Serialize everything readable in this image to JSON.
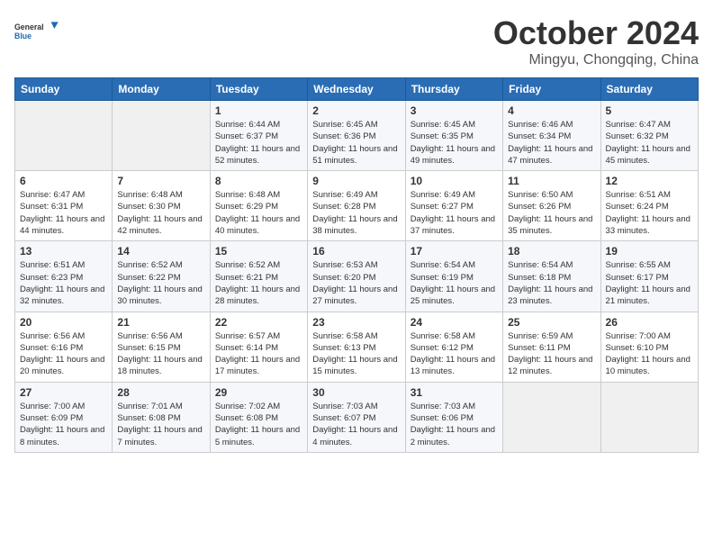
{
  "logo": {
    "general": "General",
    "blue": "Blue"
  },
  "title": "October 2024",
  "subtitle": "Mingyu, Chongqing, China",
  "weekdays": [
    "Sunday",
    "Monday",
    "Tuesday",
    "Wednesday",
    "Thursday",
    "Friday",
    "Saturday"
  ],
  "weeks": [
    [
      {
        "day": "",
        "sunrise": "",
        "sunset": "",
        "daylight": ""
      },
      {
        "day": "",
        "sunrise": "",
        "sunset": "",
        "daylight": ""
      },
      {
        "day": "1",
        "sunrise": "Sunrise: 6:44 AM",
        "sunset": "Sunset: 6:37 PM",
        "daylight": "Daylight: 11 hours and 52 minutes."
      },
      {
        "day": "2",
        "sunrise": "Sunrise: 6:45 AM",
        "sunset": "Sunset: 6:36 PM",
        "daylight": "Daylight: 11 hours and 51 minutes."
      },
      {
        "day": "3",
        "sunrise": "Sunrise: 6:45 AM",
        "sunset": "Sunset: 6:35 PM",
        "daylight": "Daylight: 11 hours and 49 minutes."
      },
      {
        "day": "4",
        "sunrise": "Sunrise: 6:46 AM",
        "sunset": "Sunset: 6:34 PM",
        "daylight": "Daylight: 11 hours and 47 minutes."
      },
      {
        "day": "5",
        "sunrise": "Sunrise: 6:47 AM",
        "sunset": "Sunset: 6:32 PM",
        "daylight": "Daylight: 11 hours and 45 minutes."
      }
    ],
    [
      {
        "day": "6",
        "sunrise": "Sunrise: 6:47 AM",
        "sunset": "Sunset: 6:31 PM",
        "daylight": "Daylight: 11 hours and 44 minutes."
      },
      {
        "day": "7",
        "sunrise": "Sunrise: 6:48 AM",
        "sunset": "Sunset: 6:30 PM",
        "daylight": "Daylight: 11 hours and 42 minutes."
      },
      {
        "day": "8",
        "sunrise": "Sunrise: 6:48 AM",
        "sunset": "Sunset: 6:29 PM",
        "daylight": "Daylight: 11 hours and 40 minutes."
      },
      {
        "day": "9",
        "sunrise": "Sunrise: 6:49 AM",
        "sunset": "Sunset: 6:28 PM",
        "daylight": "Daylight: 11 hours and 38 minutes."
      },
      {
        "day": "10",
        "sunrise": "Sunrise: 6:49 AM",
        "sunset": "Sunset: 6:27 PM",
        "daylight": "Daylight: 11 hours and 37 minutes."
      },
      {
        "day": "11",
        "sunrise": "Sunrise: 6:50 AM",
        "sunset": "Sunset: 6:26 PM",
        "daylight": "Daylight: 11 hours and 35 minutes."
      },
      {
        "day": "12",
        "sunrise": "Sunrise: 6:51 AM",
        "sunset": "Sunset: 6:24 PM",
        "daylight": "Daylight: 11 hours and 33 minutes."
      }
    ],
    [
      {
        "day": "13",
        "sunrise": "Sunrise: 6:51 AM",
        "sunset": "Sunset: 6:23 PM",
        "daylight": "Daylight: 11 hours and 32 minutes."
      },
      {
        "day": "14",
        "sunrise": "Sunrise: 6:52 AM",
        "sunset": "Sunset: 6:22 PM",
        "daylight": "Daylight: 11 hours and 30 minutes."
      },
      {
        "day": "15",
        "sunrise": "Sunrise: 6:52 AM",
        "sunset": "Sunset: 6:21 PM",
        "daylight": "Daylight: 11 hours and 28 minutes."
      },
      {
        "day": "16",
        "sunrise": "Sunrise: 6:53 AM",
        "sunset": "Sunset: 6:20 PM",
        "daylight": "Daylight: 11 hours and 27 minutes."
      },
      {
        "day": "17",
        "sunrise": "Sunrise: 6:54 AM",
        "sunset": "Sunset: 6:19 PM",
        "daylight": "Daylight: 11 hours and 25 minutes."
      },
      {
        "day": "18",
        "sunrise": "Sunrise: 6:54 AM",
        "sunset": "Sunset: 6:18 PM",
        "daylight": "Daylight: 11 hours and 23 minutes."
      },
      {
        "day": "19",
        "sunrise": "Sunrise: 6:55 AM",
        "sunset": "Sunset: 6:17 PM",
        "daylight": "Daylight: 11 hours and 21 minutes."
      }
    ],
    [
      {
        "day": "20",
        "sunrise": "Sunrise: 6:56 AM",
        "sunset": "Sunset: 6:16 PM",
        "daylight": "Daylight: 11 hours and 20 minutes."
      },
      {
        "day": "21",
        "sunrise": "Sunrise: 6:56 AM",
        "sunset": "Sunset: 6:15 PM",
        "daylight": "Daylight: 11 hours and 18 minutes."
      },
      {
        "day": "22",
        "sunrise": "Sunrise: 6:57 AM",
        "sunset": "Sunset: 6:14 PM",
        "daylight": "Daylight: 11 hours and 17 minutes."
      },
      {
        "day": "23",
        "sunrise": "Sunrise: 6:58 AM",
        "sunset": "Sunset: 6:13 PM",
        "daylight": "Daylight: 11 hours and 15 minutes."
      },
      {
        "day": "24",
        "sunrise": "Sunrise: 6:58 AM",
        "sunset": "Sunset: 6:12 PM",
        "daylight": "Daylight: 11 hours and 13 minutes."
      },
      {
        "day": "25",
        "sunrise": "Sunrise: 6:59 AM",
        "sunset": "Sunset: 6:11 PM",
        "daylight": "Daylight: 11 hours and 12 minutes."
      },
      {
        "day": "26",
        "sunrise": "Sunrise: 7:00 AM",
        "sunset": "Sunset: 6:10 PM",
        "daylight": "Daylight: 11 hours and 10 minutes."
      }
    ],
    [
      {
        "day": "27",
        "sunrise": "Sunrise: 7:00 AM",
        "sunset": "Sunset: 6:09 PM",
        "daylight": "Daylight: 11 hours and 8 minutes."
      },
      {
        "day": "28",
        "sunrise": "Sunrise: 7:01 AM",
        "sunset": "Sunset: 6:08 PM",
        "daylight": "Daylight: 11 hours and 7 minutes."
      },
      {
        "day": "29",
        "sunrise": "Sunrise: 7:02 AM",
        "sunset": "Sunset: 6:08 PM",
        "daylight": "Daylight: 11 hours and 5 minutes."
      },
      {
        "day": "30",
        "sunrise": "Sunrise: 7:03 AM",
        "sunset": "Sunset: 6:07 PM",
        "daylight": "Daylight: 11 hours and 4 minutes."
      },
      {
        "day": "31",
        "sunrise": "Sunrise: 7:03 AM",
        "sunset": "Sunset: 6:06 PM",
        "daylight": "Daylight: 11 hours and 2 minutes."
      },
      {
        "day": "",
        "sunrise": "",
        "sunset": "",
        "daylight": ""
      },
      {
        "day": "",
        "sunrise": "",
        "sunset": "",
        "daylight": ""
      }
    ]
  ]
}
